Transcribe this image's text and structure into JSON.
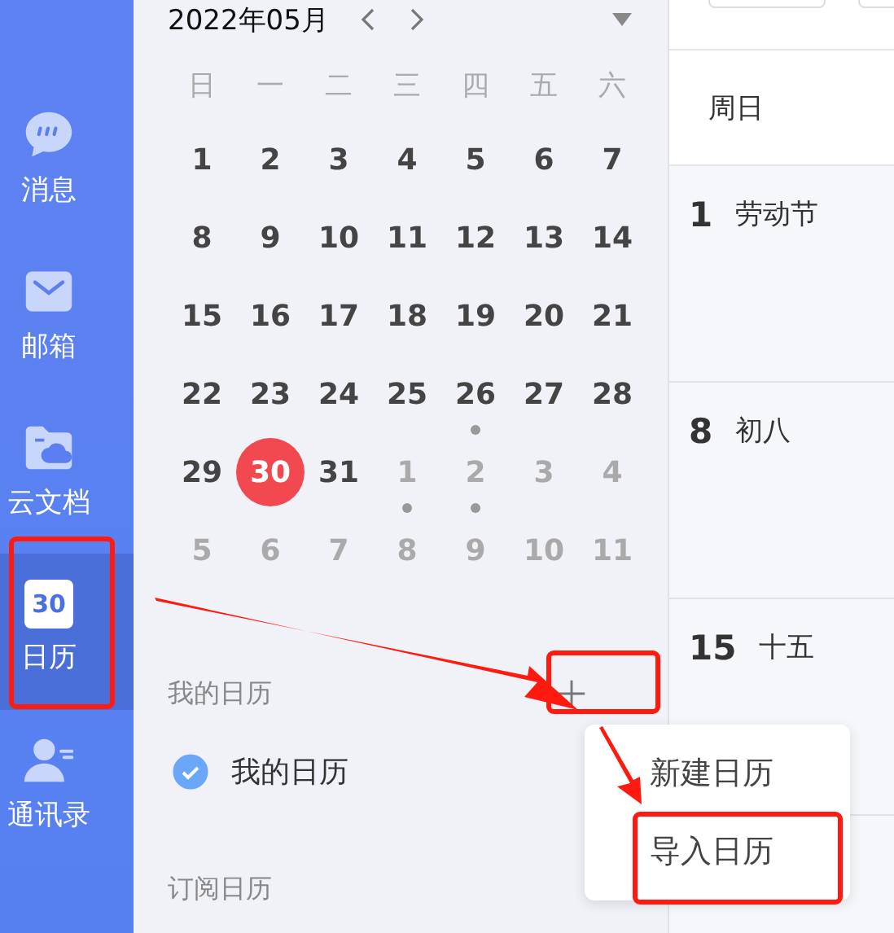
{
  "sidebar": {
    "items": [
      {
        "label": "消息",
        "selected": false
      },
      {
        "label": "邮箱",
        "selected": false
      },
      {
        "label": "云文档",
        "selected": false
      },
      {
        "label": "日历",
        "selected": true,
        "icon_text": "30"
      },
      {
        "label": "通讯录",
        "selected": false
      }
    ]
  },
  "calendar": {
    "month": "2022年05月",
    "weekdays": [
      "日",
      "一",
      "二",
      "三",
      "四",
      "五",
      "六"
    ],
    "weeks": [
      [
        {
          "label": "1",
          "muted": false,
          "dot": false,
          "selected": false
        },
        {
          "label": "2",
          "muted": false,
          "dot": false,
          "selected": false
        },
        {
          "label": "3",
          "muted": false,
          "dot": false,
          "selected": false
        },
        {
          "label": "4",
          "muted": false,
          "dot": false,
          "selected": false
        },
        {
          "label": "5",
          "muted": false,
          "dot": false,
          "selected": false
        },
        {
          "label": "6",
          "muted": false,
          "dot": false,
          "selected": false
        },
        {
          "label": "7",
          "muted": false,
          "dot": false,
          "selected": false
        }
      ],
      [
        {
          "label": "8",
          "muted": false,
          "dot": false,
          "selected": false
        },
        {
          "label": "9",
          "muted": false,
          "dot": false,
          "selected": false
        },
        {
          "label": "10",
          "muted": false,
          "dot": false,
          "selected": false
        },
        {
          "label": "11",
          "muted": false,
          "dot": false,
          "selected": false
        },
        {
          "label": "12",
          "muted": false,
          "dot": false,
          "selected": false
        },
        {
          "label": "13",
          "muted": false,
          "dot": false,
          "selected": false
        },
        {
          "label": "14",
          "muted": false,
          "dot": false,
          "selected": false
        }
      ],
      [
        {
          "label": "15",
          "muted": false,
          "dot": false,
          "selected": false
        },
        {
          "label": "16",
          "muted": false,
          "dot": false,
          "selected": false
        },
        {
          "label": "17",
          "muted": false,
          "dot": false,
          "selected": false
        },
        {
          "label": "18",
          "muted": false,
          "dot": false,
          "selected": false
        },
        {
          "label": "19",
          "muted": false,
          "dot": false,
          "selected": false
        },
        {
          "label": "20",
          "muted": false,
          "dot": false,
          "selected": false
        },
        {
          "label": "21",
          "muted": false,
          "dot": false,
          "selected": false
        }
      ],
      [
        {
          "label": "22",
          "muted": false,
          "dot": false,
          "selected": false
        },
        {
          "label": "23",
          "muted": false,
          "dot": false,
          "selected": false
        },
        {
          "label": "24",
          "muted": false,
          "dot": false,
          "selected": false
        },
        {
          "label": "25",
          "muted": false,
          "dot": false,
          "selected": false
        },
        {
          "label": "26",
          "muted": false,
          "dot": true,
          "selected": false
        },
        {
          "label": "27",
          "muted": false,
          "dot": false,
          "selected": false
        },
        {
          "label": "28",
          "muted": false,
          "dot": false,
          "selected": false
        }
      ],
      [
        {
          "label": "29",
          "muted": false,
          "dot": false,
          "selected": false
        },
        {
          "label": "30",
          "muted": false,
          "dot": false,
          "selected": true
        },
        {
          "label": "31",
          "muted": false,
          "dot": false,
          "selected": false
        },
        {
          "label": "1",
          "muted": true,
          "dot": true,
          "selected": false
        },
        {
          "label": "2",
          "muted": true,
          "dot": true,
          "selected": false
        },
        {
          "label": "3",
          "muted": true,
          "dot": false,
          "selected": false
        },
        {
          "label": "4",
          "muted": true,
          "dot": false,
          "selected": false
        }
      ],
      [
        {
          "label": "5",
          "muted": true,
          "dot": false,
          "selected": false
        },
        {
          "label": "6",
          "muted": true,
          "dot": false,
          "selected": false
        },
        {
          "label": "7",
          "muted": true,
          "dot": false,
          "selected": false
        },
        {
          "label": "8",
          "muted": true,
          "dot": false,
          "selected": false
        },
        {
          "label": "9",
          "muted": true,
          "dot": false,
          "selected": false
        },
        {
          "label": "10",
          "muted": true,
          "dot": false,
          "selected": false
        },
        {
          "label": "11",
          "muted": true,
          "dot": false,
          "selected": false
        }
      ]
    ]
  },
  "my_calendars": {
    "title": "我的日历",
    "items": [
      {
        "label": "我的日历",
        "checked": true
      }
    ]
  },
  "subscribed_calendars": {
    "title": "订阅日历"
  },
  "add_menu": {
    "items": [
      {
        "label": "新建日历"
      },
      {
        "label": "导入日历"
      }
    ]
  },
  "week_view": {
    "header": "周日",
    "cells": [
      {
        "date": "1",
        "note": "劳动节"
      },
      {
        "date": "8",
        "note": "初八"
      },
      {
        "date": "15",
        "note": "十五"
      }
    ]
  }
}
